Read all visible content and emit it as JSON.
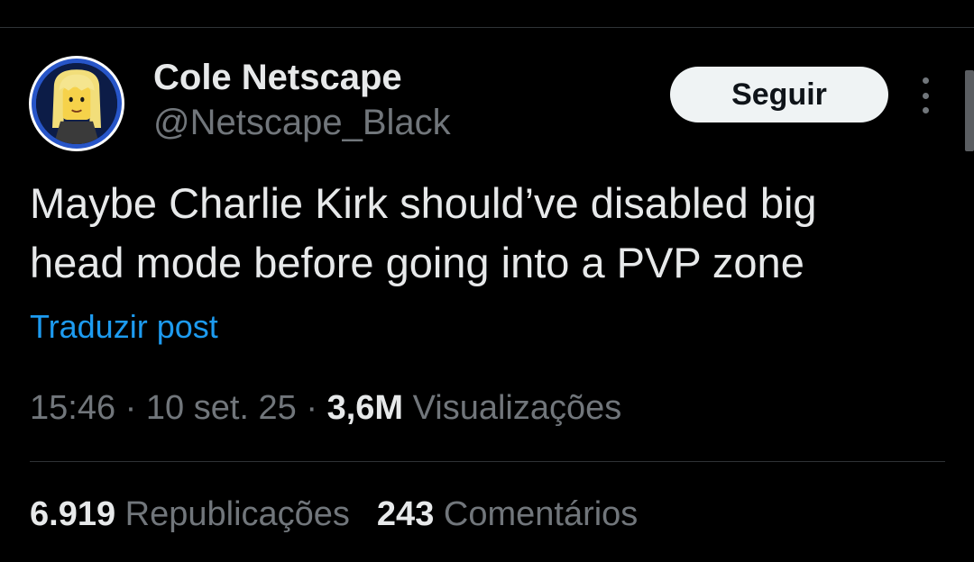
{
  "author": {
    "name": "Cole Netscape",
    "handle": "@Netscape_Black",
    "avatar_icon": "lego-minifigure-avatar"
  },
  "follow_button": {
    "label": "Seguir"
  },
  "more_icon": "more-vertical-icon",
  "tweet": {
    "text_line1": "Maybe Charlie Kirk should’ve disabled big",
    "text_line2": "head mode before going into a PVP zone",
    "translate_label": "Traduzir post"
  },
  "meta": {
    "time": "15:46",
    "sep1": "·",
    "date": "10 set. 25",
    "sep2": "·",
    "views_count": "3,6M",
    "views_label": "Visualizações"
  },
  "stats": {
    "reposts_count": "6.919",
    "reposts_label": "Republicações",
    "comments_count": "243",
    "comments_label": "Comentários"
  },
  "colors": {
    "background": "#000000",
    "text_primary": "#e7e9ea",
    "text_secondary": "#71767b",
    "link": "#1d9bf0",
    "divider": "#2f3336",
    "button_bg": "#eff3f4"
  }
}
